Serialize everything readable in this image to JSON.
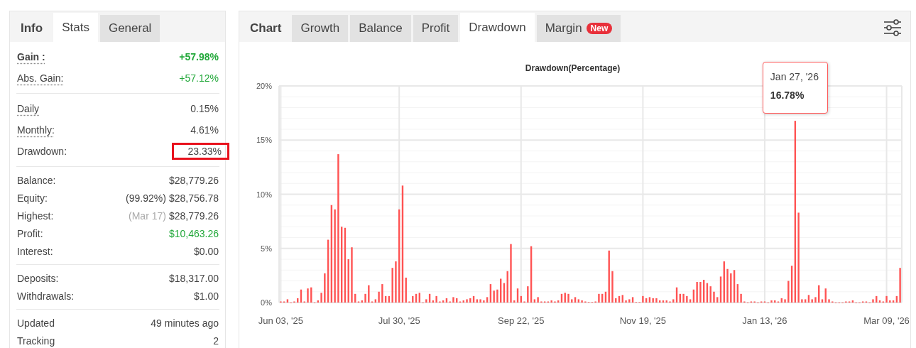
{
  "stats_panel": {
    "tabs": [
      {
        "label": "Info",
        "kind": "plain",
        "selected": false
      },
      {
        "label": "Stats",
        "kind": "tab",
        "selected": true
      },
      {
        "label": "General",
        "kind": "tab",
        "selected": false
      }
    ],
    "groups": [
      {
        "rows": [
          {
            "label": "Gain :",
            "value": "+57.98%",
            "positive": true,
            "emphasis": true,
            "underlined": true,
            "highlighted": false
          },
          {
            "label": "Abs. Gain:",
            "value": "+57.12%",
            "positive": true,
            "emphasis": false,
            "underlined": true,
            "highlighted": false
          }
        ]
      },
      {
        "rows": [
          {
            "label": "Daily",
            "value": "0.15%",
            "positive": false,
            "emphasis": false,
            "underlined": true,
            "highlighted": false
          },
          {
            "label": "Monthly:",
            "value": "4.61%",
            "positive": false,
            "emphasis": false,
            "underlined": true,
            "highlighted": false
          },
          {
            "label": "Drawdown:",
            "value": "23.33%",
            "positive": false,
            "emphasis": false,
            "underlined": false,
            "highlighted": true
          }
        ]
      },
      {
        "rows": [
          {
            "label": "Balance:",
            "value": "$28,779.26",
            "positive": false,
            "emphasis": false,
            "underlined": false,
            "highlighted": false
          },
          {
            "label": "Equity:",
            "note": "(99.92%)",
            "muted": false,
            "value": "$28,756.78",
            "positive": false,
            "emphasis": false,
            "underlined": false,
            "highlighted": false
          },
          {
            "label": "Highest:",
            "note": "(Mar 17)",
            "muted": true,
            "value": "$28,779.26",
            "positive": false,
            "emphasis": false,
            "underlined": false,
            "highlighted": false
          },
          {
            "label": "Profit:",
            "value": "$10,463.26",
            "positive": true,
            "emphasis": false,
            "underlined": false,
            "highlighted": false
          },
          {
            "label": "Interest:",
            "value": "$0.00",
            "positive": false,
            "emphasis": false,
            "underlined": false,
            "highlighted": false
          }
        ]
      },
      {
        "rows": [
          {
            "label": "Deposits:",
            "value": "$18,317.00",
            "positive": false,
            "emphasis": false,
            "underlined": false,
            "highlighted": false
          },
          {
            "label": "Withdrawals:",
            "value": "$1.00",
            "positive": false,
            "emphasis": false,
            "underlined": false,
            "highlighted": false
          }
        ]
      },
      {
        "rows": [
          {
            "label": "Updated",
            "value": "49 minutes ago",
            "positive": false,
            "emphasis": false,
            "underlined": false,
            "highlighted": false
          },
          {
            "label": "Tracking",
            "value": "2",
            "positive": false,
            "emphasis": false,
            "underlined": false,
            "highlighted": false
          }
        ]
      }
    ]
  },
  "chart_panel": {
    "tabs": [
      {
        "label": "Chart",
        "kind": "plain",
        "selected": false
      },
      {
        "label": "Growth",
        "kind": "tab",
        "selected": false
      },
      {
        "label": "Balance",
        "kind": "tab",
        "selected": false
      },
      {
        "label": "Profit",
        "kind": "tab",
        "selected": false
      },
      {
        "label": "Drawdown",
        "kind": "tab",
        "selected": true
      },
      {
        "label": "Margin",
        "kind": "tab",
        "selected": false,
        "badge": "New"
      }
    ],
    "tooltip": {
      "date": "Jan 27, '26",
      "value": "16.78%"
    },
    "chart_data": {
      "type": "bar",
      "title": "Drawdown(Percentage)",
      "grid": true,
      "ylim": [
        0,
        20
      ],
      "categories": [
        "Jun 03, '25",
        null,
        null,
        null,
        null,
        null,
        null,
        null,
        null,
        null,
        null,
        null,
        null,
        null,
        null,
        null,
        null,
        null,
        null,
        null,
        null,
        null,
        null,
        null,
        null,
        null,
        null,
        null,
        null,
        null,
        null,
        null,
        null,
        null,
        null,
        "Jul 30, '25",
        null,
        null,
        null,
        null,
        null,
        null,
        null,
        null,
        null,
        null,
        null,
        null,
        null,
        null,
        null,
        null,
        null,
        null,
        null,
        null,
        null,
        null,
        null,
        null,
        null,
        null,
        null,
        null,
        null,
        null,
        null,
        null,
        null,
        null,
        null,
        "Sep 22, '25",
        null,
        null,
        null,
        null,
        null,
        null,
        null,
        null,
        null,
        null,
        null,
        null,
        null,
        null,
        null,
        null,
        null,
        null,
        null,
        null,
        null,
        null,
        null,
        null,
        null,
        null,
        null,
        null,
        null,
        null,
        null,
        null,
        null,
        null,
        null,
        "Nov 19, '25",
        null,
        null,
        null,
        null,
        null,
        null,
        null,
        null,
        null,
        null,
        null,
        null,
        null,
        null,
        null,
        null,
        null,
        null,
        null,
        null,
        null,
        null,
        null,
        null,
        null,
        null,
        null,
        null,
        null,
        null,
        null,
        null,
        null,
        null,
        null,
        "Jan 13, '26",
        null,
        null,
        null,
        null,
        null,
        null,
        null,
        null,
        null,
        null,
        null,
        null,
        null,
        null,
        null,
        null,
        null,
        null,
        null,
        null,
        null,
        null,
        null,
        null,
        null,
        null,
        null,
        null,
        null,
        null,
        null,
        null,
        null,
        null,
        null,
        "Mar 09, '26",
        null,
        null,
        null,
        null
      ],
      "yticks": [
        {
          "value": 0,
          "label": "0%"
        },
        {
          "value": 5,
          "label": "5%"
        },
        {
          "value": 10,
          "label": "10%"
        },
        {
          "value": 15,
          "label": "15%"
        },
        {
          "value": 20,
          "label": "20%"
        }
      ],
      "series": [
        {
          "color": "#ff5353",
          "values": [
            0.1,
            0.1,
            0.3,
            0,
            0.1,
            0.4,
            1.2,
            0.1,
            1.3,
            1.4,
            0,
            0.2,
            0.9,
            2.7,
            5.8,
            9.0,
            8.6,
            13.7,
            7.0,
            6.9,
            4.0,
            5.1,
            0.8,
            0.1,
            0.2,
            0.8,
            1.6,
            0.1,
            0.3,
            1.0,
            1.7,
            0.6,
            0.6,
            3.2,
            3.8,
            8.6,
            10.8,
            2.3,
            0.1,
            0.6,
            0.8,
            0.9,
            0,
            0.3,
            0.8,
            0.2,
            0.6,
            0.1,
            0.2,
            0.4,
            0.1,
            0.5,
            0.4,
            0.1,
            0.2,
            0.3,
            0.4,
            0.6,
            0.3,
            0.3,
            0.2,
            0.5,
            1.7,
            1.1,
            1.2,
            2.2,
            1.8,
            2.9,
            5.4,
            0.2,
            1.3,
            0.6,
            0.1,
            1.5,
            5.2,
            0.3,
            0.5,
            0.1,
            0.1,
            0.1,
            0.2,
            0.1,
            0.2,
            0.8,
            0.9,
            0.8,
            0.3,
            0.5,
            0.3,
            0.2,
            0.1,
            0.05,
            0.05,
            0.1,
            0.8,
            0.8,
            1.0,
            4.8,
            2.9,
            0.4,
            0.6,
            0.7,
            0.2,
            0.3,
            0.5,
            0.05,
            0.05,
            0.6,
            0.4,
            0.5,
            0.4,
            0.4,
            0.2,
            0.2,
            0.2,
            0.1,
            0.3,
            1.4,
            0.8,
            0.8,
            0.6,
            0.3,
            1.2,
            1.9,
            1.9,
            2.1,
            1.8,
            1.5,
            1.0,
            0.5,
            2.4,
            3.8,
            3.1,
            2.7,
            3.0,
            1.7,
            0.8,
            0.1,
            0,
            0.1,
            0.1,
            0,
            0.1,
            0.1,
            0,
            0.2,
            0.2,
            0.1,
            0.4,
            0.3,
            2.0,
            3.4,
            16.78,
            8.3,
            0.3,
            0.3,
            0.7,
            0.3,
            0.5,
            1.6,
            0.3,
            1.3,
            0.3,
            0.1,
            0,
            0,
            0,
            0.1,
            0.1,
            0.2,
            0,
            0,
            0.1,
            0.1,
            0,
            0.3,
            0.6,
            0.2,
            0.1,
            0.6,
            0.2,
            0.2,
            0.6,
            3.2
          ]
        }
      ]
    }
  }
}
